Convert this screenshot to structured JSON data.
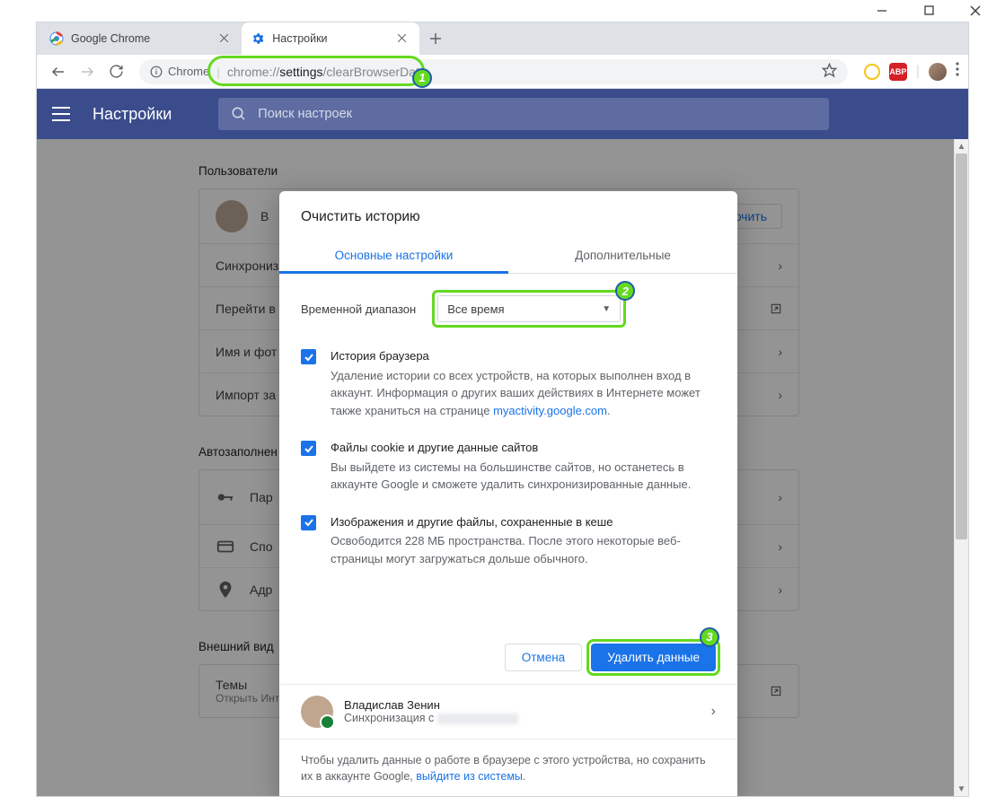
{
  "window": {
    "tab1": "Google Chrome",
    "tab2": "Настройки"
  },
  "toolbar": {
    "secure_label": "Chrome",
    "url_prefix": "chrome://",
    "url_mid": "settings",
    "url_suffix": "/clearBrowserData",
    "abp": "ABP"
  },
  "header": {
    "title": "Настройки",
    "search_placeholder": "Поиск настроек"
  },
  "bg": {
    "section_users": "Пользователи",
    "user_name": "В",
    "btn_enable": "ключить",
    "row_sync": "Синхрониз",
    "row_goto": "Перейти в",
    "row_name": "Имя и фот",
    "row_import": "Импорт за",
    "section_autofill": "Автозаполнен",
    "row_pwd": "Пар",
    "row_pay": "Спо",
    "row_addr": "Адр",
    "section_look": "Внешний вид",
    "row_theme": "Темы",
    "row_theme_sub": "Открыть Интернет-магазин Chrome"
  },
  "modal": {
    "title": "Очистить историю",
    "tab_basic": "Основные настройки",
    "tab_adv": "Дополнительные",
    "timerange_label": "Временной диапазон",
    "timerange_value": "Все время",
    "opt1_title": "История браузера",
    "opt1_desc_a": "Удаление истории со всех устройств, на которых выполнен вход в аккаунт. Информация о других ваших действиях в Интернете может также храниться на странице ",
    "opt1_link": "myactivity.google.com",
    "opt2_title": "Файлы cookie и другие данные сайтов",
    "opt2_desc": "Вы выйдете из системы на большинстве сайтов, но останетесь в аккаунте Google и сможете удалить синхронизированные данные.",
    "opt3_title": "Изображения и другие файлы, сохраненные в кеше",
    "opt3_desc": "Освободится 228 МБ пространства. После этого некоторые веб-страницы могут загружаться дольше обычного.",
    "cancel": "Отмена",
    "confirm": "Удалить данные",
    "user_name": "Владислав Зенин",
    "sync_prefix": "Синхронизация с ",
    "footnote_a": "Чтобы удалить данные о работе в браузере с этого устройства, но сохранить их в аккаунте Google, ",
    "footnote_link": "выйдите из системы",
    "footnote_b": "."
  },
  "badges": {
    "n1": "1",
    "n2": "2",
    "n3": "3"
  }
}
